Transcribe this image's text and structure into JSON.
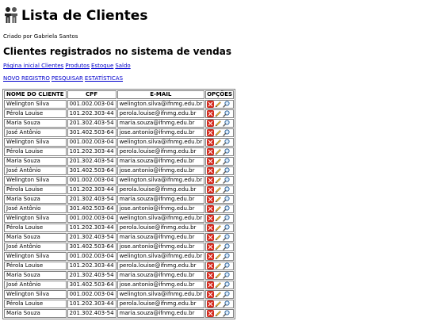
{
  "header": {
    "title": "Lista de Clientes",
    "logo_icon": "people-icon"
  },
  "credit": "Criado por Gabriela Santos",
  "section_title": "Clientes registrados no sistema de vendas",
  "nav": [
    "Página inicial Clientes",
    "Produtos",
    "Estoque",
    "Saldo"
  ],
  "actions": [
    "NOVO REGISTRO",
    "PESQUISAR",
    "ESTATÍSTICAS"
  ],
  "table": {
    "headers": [
      "NOME DO CLIENTE",
      "CPF",
      "E-MAIL",
      "OPÇÕES"
    ],
    "row_icons": [
      "delete-icon",
      "edit-pencil-icon",
      "search-magnifier-icon"
    ],
    "rows": [
      [
        "Welington Silva",
        "001.002.003-04",
        "welington.silva@ifnmg.edu.br"
      ],
      [
        "Pérola Louise",
        "101.202.303-44",
        "perola.louise@ifnmg.edu.br"
      ],
      [
        "Maria Souza",
        "201.302.403-54",
        "maria.souza@ifnmg.edu.br"
      ],
      [
        "José Antônio",
        "301.402.503-64",
        "jose.antonio@ifnmg.edu.br"
      ],
      [
        "Welington Silva",
        "001.002.003-04",
        "welington.silva@ifnmg.edu.br"
      ],
      [
        "Pérola Louise",
        "101.202.303-44",
        "perola.louise@ifnmg.edu.br"
      ],
      [
        "Maria Souza",
        "201.302.403-54",
        "maria.souza@ifnmg.edu.br"
      ],
      [
        "José Antônio",
        "301.402.503-64",
        "jose.antonio@ifnmg.edu.br"
      ],
      [
        "Welington Silva",
        "001.002.003-04",
        "welington.silva@ifnmg.edu.br"
      ],
      [
        "Pérola Louise",
        "101.202.303-44",
        "perola.louise@ifnmg.edu.br"
      ],
      [
        "Maria Souza",
        "201.302.403-54",
        "maria.souza@ifnmg.edu.br"
      ],
      [
        "José Antônio",
        "301.402.503-64",
        "jose.antonio@ifnmg.edu.br"
      ],
      [
        "Welington Silva",
        "001.002.003-04",
        "welington.silva@ifnmg.edu.br"
      ],
      [
        "Pérola Louise",
        "101.202.303-44",
        "perola.louise@ifnmg.edu.br"
      ],
      [
        "Maria Souza",
        "201.302.403-54",
        "maria.souza@ifnmg.edu.br"
      ],
      [
        "José Antônio",
        "301.402.503-64",
        "jose.antonio@ifnmg.edu.br"
      ],
      [
        "Welington Silva",
        "001.002.003-04",
        "welington.silva@ifnmg.edu.br"
      ],
      [
        "Pérola Louise",
        "101.202.303-44",
        "perola.louise@ifnmg.edu.br"
      ],
      [
        "Maria Souza",
        "201.302.403-54",
        "maria.souza@ifnmg.edu.br"
      ],
      [
        "José Antônio",
        "301.402.503-64",
        "jose.antonio@ifnmg.edu.br"
      ],
      [
        "Welington Silva",
        "001.002.003-04",
        "welington.silva@ifnmg.edu.br"
      ],
      [
        "Pérola Louise",
        "101.202.303-44",
        "perola.louise@ifnmg.edu.br"
      ],
      [
        "Maria Souza",
        "201.302.403-54",
        "maria.souza@ifnmg.edu.br"
      ]
    ]
  },
  "colors": {
    "link": "#0000cc",
    "delete": "#d42a1d",
    "border": "#808080"
  }
}
